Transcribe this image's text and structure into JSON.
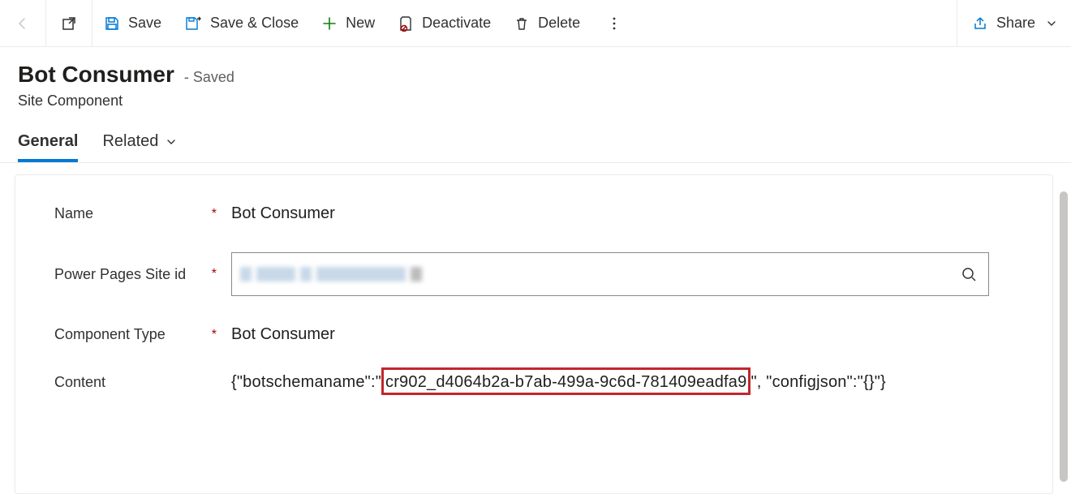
{
  "toolbar": {
    "save": "Save",
    "saveClose": "Save & Close",
    "new": "New",
    "deactivate": "Deactivate",
    "delete": "Delete",
    "share": "Share"
  },
  "header": {
    "title": "Bot Consumer",
    "status": "- Saved",
    "entity": "Site Component"
  },
  "tabs": {
    "general": "General",
    "related": "Related"
  },
  "form": {
    "nameLabel": "Name",
    "nameValue": "Bot Consumer",
    "siteIdLabel": "Power Pages Site id",
    "compTypeLabel": "Component Type",
    "compTypeValue": "Bot Consumer",
    "contentLabel": "Content",
    "contentPrefix": "{\"botschemaname\":\"",
    "contentHighlighted": "cr902_d4064b2a-b7ab-499a-9c6d-781409eadfa9",
    "contentSuffix": "\", \"configjson\":\"{}\"}"
  }
}
